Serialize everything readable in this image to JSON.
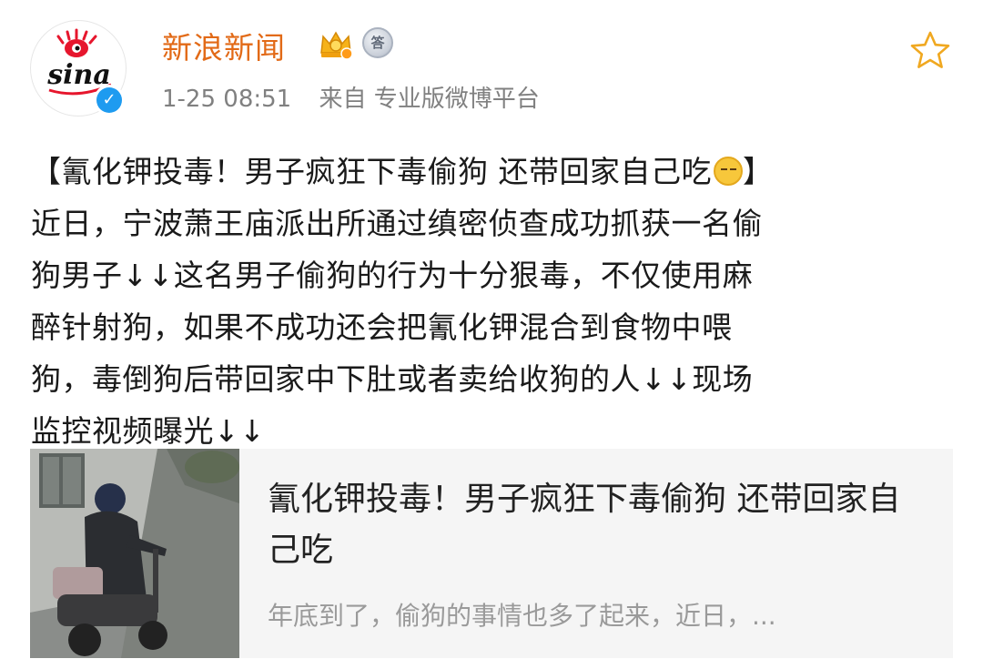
{
  "user": {
    "name": "新浪新闻",
    "avatar_logo_text": "sina",
    "answer_badge": "答",
    "time": "1-25 08:51",
    "source": "来自 专业版微博平台"
  },
  "post": {
    "title_open": "【氰化钾投毒！男子疯狂下毒偷狗 还带回家自己吃",
    "title_close": "】",
    "lines": [
      "近日，宁波萧王庙派出所通过缜密侦查成功抓获一名偷",
      "狗男子↓↓这名男子偷狗的行为十分狠毒，不仅使用麻",
      "醉针射狗，如果不成功还会把氰化钾混合到食物中喂",
      "狗，毒倒狗后带回家中下肚或者卖给收狗的人↓↓现场",
      "监控视频曝光↓↓"
    ]
  },
  "card": {
    "title": "氰化钾投毒！男子疯狂下毒偷狗 还带回家自己吃",
    "description": "年底到了，偷狗的事情也多了起来，近日，..."
  },
  "colors": {
    "username": "#e26a17",
    "meta": "#808080",
    "verified": "#1e9bf0",
    "card_bg": "#f5f5f5"
  },
  "icons": [
    "sina-logo-icon",
    "verified-icon",
    "vip-crown-icon",
    "answer-badge-icon",
    "favorite-star-icon",
    "emoji-icon",
    "video-thumbnail"
  ]
}
